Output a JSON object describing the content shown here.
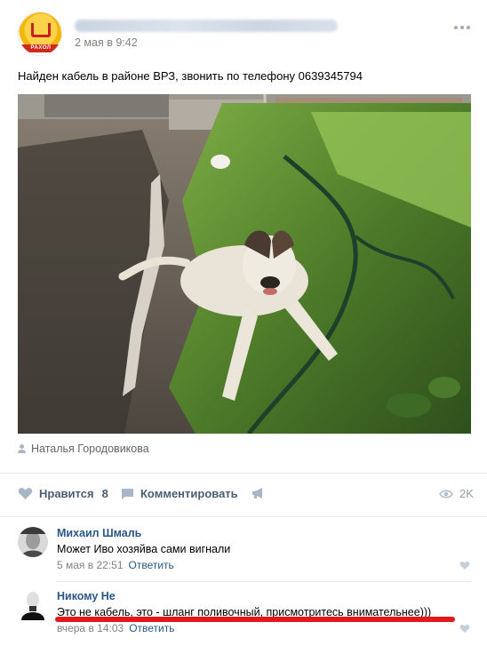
{
  "post": {
    "date": "2 мая в 9:42",
    "text": "Найден кабель в районе ВРЗ, звонить по телефону 0639345794",
    "avatar_banner": "РАХОЛ",
    "author": "Наталья Городовикова"
  },
  "actions": {
    "like_label": "Нравится",
    "like_count": "8",
    "comment_label": "Комментировать",
    "views": "2K"
  },
  "comments": [
    {
      "author": "Михаил Шмаль",
      "text": "Может Иво хозяйва сами вигнали",
      "time": "5 мая в 22:51",
      "reply": "Ответить"
    },
    {
      "author": "Никому Не",
      "text": "Это не кабель, это - шланг поливочный, присмотритесь внимательнее)))",
      "time": "вчера в 14:03",
      "reply": "Ответить"
    }
  ],
  "colors": {
    "link": "#2a5885",
    "action": "#4a5d74",
    "meta": "#828282",
    "underline": "#e4171b"
  }
}
